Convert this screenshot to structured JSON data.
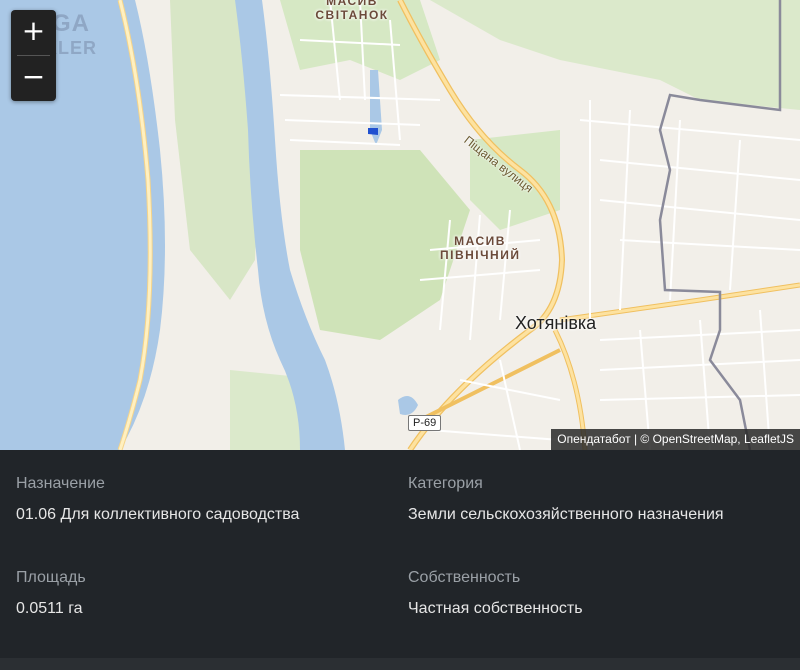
{
  "map": {
    "watermark": {
      "line1": "MEGA",
      "line2": "MAKLER"
    },
    "zoom": {
      "in_label": "+",
      "out_label": "−"
    },
    "labels": {
      "district_top": "МАСИВ\nСВІТАНОК",
      "district_mid": "МАСИВ\nПІВНІЧНИЙ",
      "town": "Хотянівка",
      "street": "Піщана вулиця",
      "road_shield": "Р-69"
    },
    "attribution": "Опендатабот | © OpenStreetMap, LeafletJS"
  },
  "details": {
    "purpose": {
      "label": "Назначение",
      "value": "01.06 Для коллективного садоводства"
    },
    "category": {
      "label": "Категория",
      "value": "Земли сельскохозяйственного назначения"
    },
    "area": {
      "label": "Площадь",
      "value": "0.0511 га"
    },
    "ownership": {
      "label": "Собственность",
      "value": "Частная собственность"
    }
  }
}
